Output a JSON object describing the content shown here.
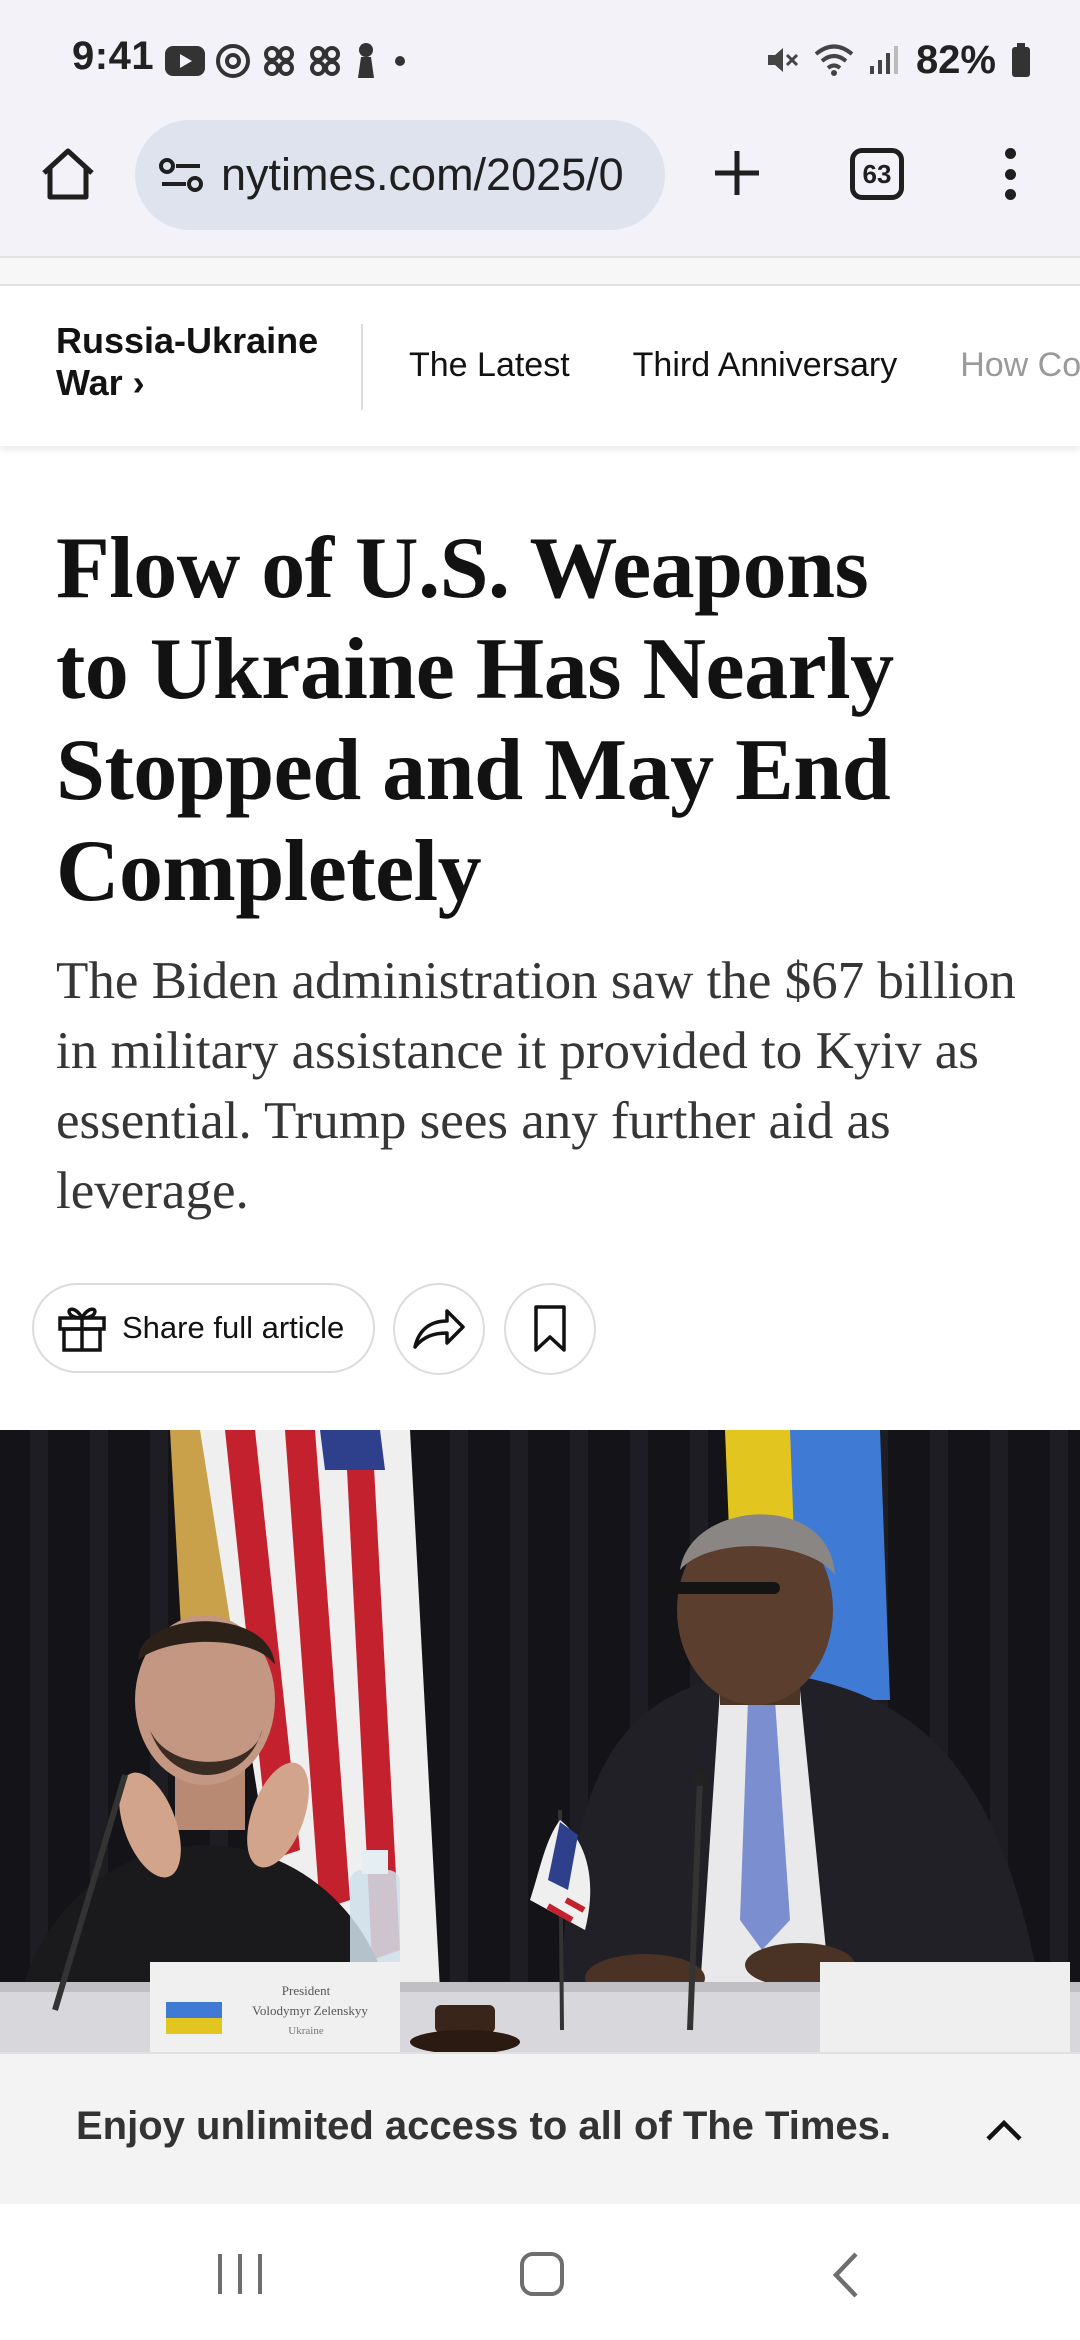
{
  "status_bar": {
    "time": "9:41",
    "battery": "82%",
    "left_icons": [
      "youtube-icon",
      "threads-icon",
      "pinwheel-icon",
      "pinwheel-icon",
      "chess-pawn-icon",
      "dot-icon"
    ],
    "right_icons": [
      "mute-icon",
      "wifi-icon",
      "signal-icon",
      "battery-icon"
    ]
  },
  "browser": {
    "url": "nytimes.com/2025/0",
    "tab_count": "63",
    "icons": [
      "home-icon",
      "site-info-icon",
      "new-tab-icon",
      "tab-switcher-icon",
      "overflow-menu-icon"
    ]
  },
  "section_nav": {
    "title": "Russia-Ukraine War ›",
    "links": [
      "The Latest",
      "Third Anniversary",
      "How Co"
    ]
  },
  "article": {
    "headline": "Flow of U.S. Weapons to Ukraine Has Nearly Stopped and May End Completely",
    "summary": "The Biden administration saw the $67 billion in military assistance it provided to Kyiv as essential. Trump sees any further aid as leverage."
  },
  "actions": {
    "share_label": "Share full article",
    "icons": [
      "gift-icon",
      "share-arrow-icon",
      "bookmark-icon"
    ]
  },
  "photo": {
    "placard_lines": [
      "President",
      "Volodymyr Zelenskyy",
      "Ukraine"
    ]
  },
  "paywall": {
    "text": "Enjoy unlimited access to all of The Times."
  },
  "colors": {
    "chrome_bg": "#f2f2f8",
    "url_pill": "#dfe3ee",
    "text": "#121212",
    "summary_text": "#363636",
    "paywall_bg": "#f3f3f3"
  }
}
